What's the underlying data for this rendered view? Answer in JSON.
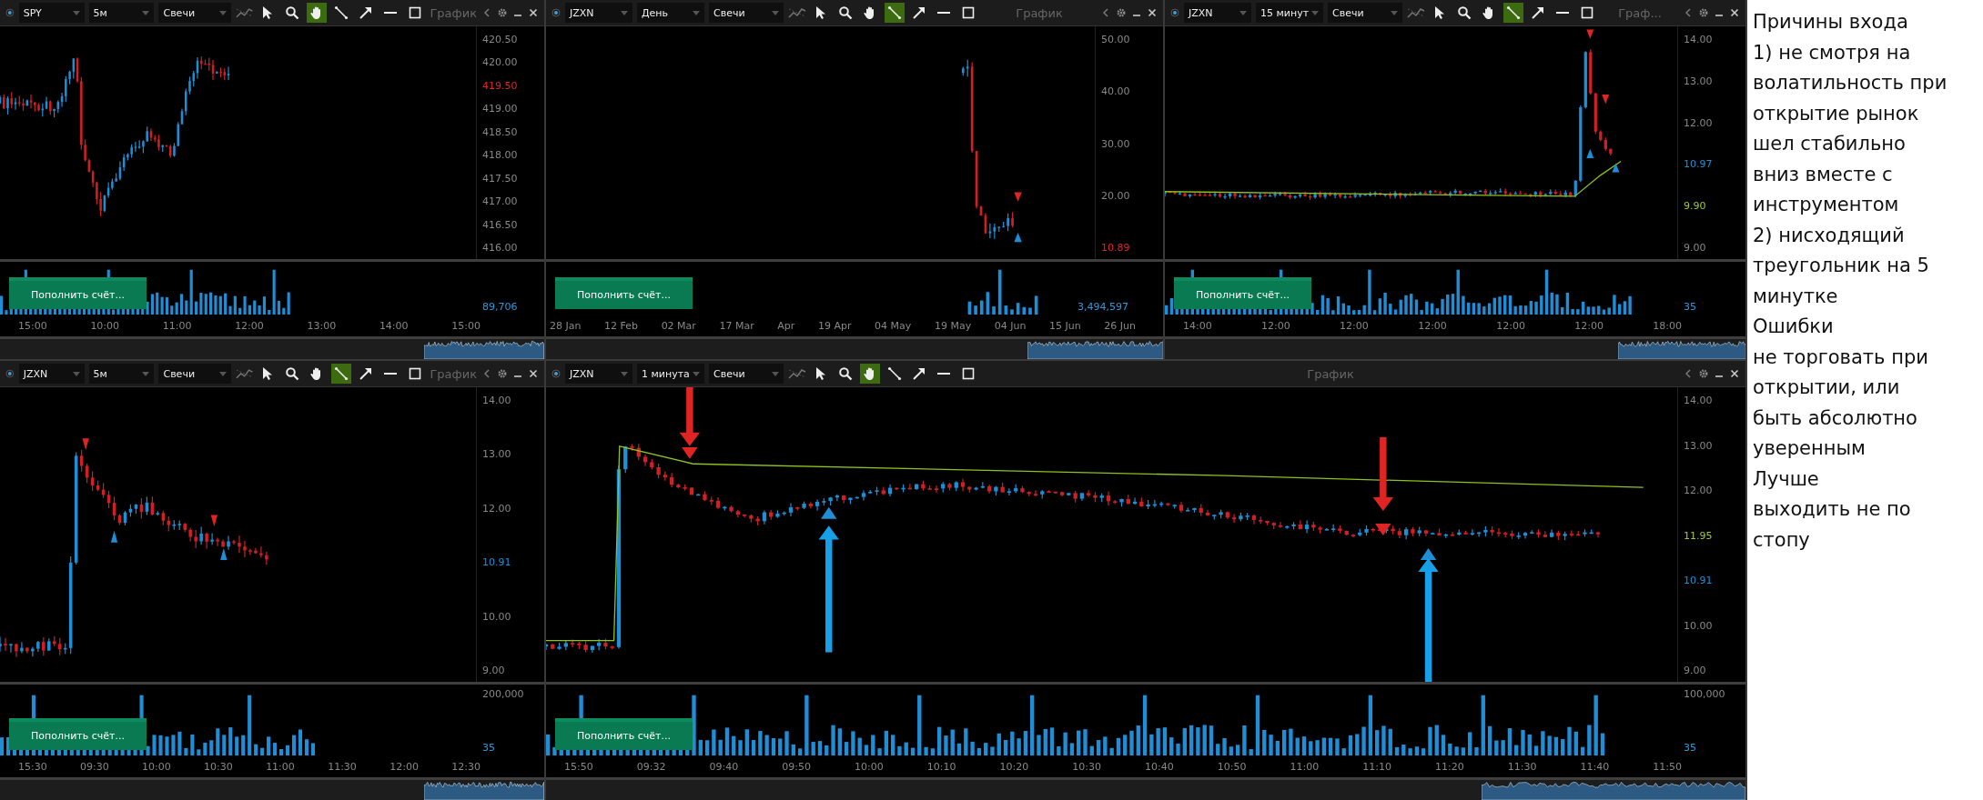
{
  "charts": [
    {
      "symbol": "SPY",
      "interval": "5м",
      "chart_type": "Свечи",
      "title": "График",
      "tools": [
        {
          "kind": "pointer",
          "selected": false
        },
        {
          "kind": "zoom",
          "selected": false
        },
        {
          "kind": "hand",
          "selected": true
        },
        {
          "kind": "line",
          "selected": false
        },
        {
          "kind": "arrow",
          "selected": false
        },
        {
          "kind": "hline",
          "selected": false
        },
        {
          "kind": "rectangle",
          "selected": false
        }
      ],
      "price_axis": [
        {
          "kind": "tick",
          "text": "420.50"
        },
        {
          "kind": "tick",
          "text": "420.00"
        },
        {
          "kind": "tag",
          "text": "419.50",
          "color": "#e02424"
        },
        {
          "kind": "tick",
          "text": "419.00"
        },
        {
          "kind": "tick",
          "text": "418.50"
        },
        {
          "kind": "tick",
          "text": "418.00"
        },
        {
          "kind": "tick",
          "text": "417.50"
        },
        {
          "kind": "tick",
          "text": "417.00"
        },
        {
          "kind": "tick",
          "text": "416.50"
        },
        {
          "kind": "tick",
          "text": "416.00"
        }
      ],
      "volume_axis": [
        {
          "kind": "tag",
          "text": "89,706"
        }
      ],
      "deposit_button": "Пополнить счёт...",
      "time_axis": [
        "15:00",
        "10:00",
        "11:00",
        "12:00",
        "13:00",
        "14:00",
        "15:00"
      ]
    },
    {
      "symbol": "JZXN",
      "interval": "День",
      "chart_type": "Свечи",
      "title": "График",
      "tools": [
        {
          "kind": "pointer",
          "selected": false
        },
        {
          "kind": "zoom",
          "selected": false
        },
        {
          "kind": "hand",
          "selected": false
        },
        {
          "kind": "line",
          "selected": true
        },
        {
          "kind": "arrow",
          "selected": false
        },
        {
          "kind": "hline",
          "selected": false
        },
        {
          "kind": "rectangle",
          "selected": false
        }
      ],
      "price_axis": [
        {
          "kind": "tick",
          "text": "50.00"
        },
        {
          "kind": "tick",
          "text": "40.00"
        },
        {
          "kind": "tick",
          "text": "30.00"
        },
        {
          "kind": "tick",
          "text": "20.00"
        },
        {
          "kind": "tag",
          "text": "10.89",
          "color": "#e02424"
        }
      ],
      "volume_axis": [
        {
          "kind": "tag",
          "text": "3,494,597"
        }
      ],
      "deposit_button": "Пополнить счёт...",
      "time_axis": [
        "28 Jan",
        "12 Feb",
        "02 Mar",
        "17 Mar",
        "Apr",
        "19 Apr",
        "04 May",
        "19 May",
        "04 Jun",
        "15 Jun",
        "26 Jun"
      ]
    },
    {
      "symbol": "JZXN",
      "interval": "15 минут",
      "chart_type": "Свечи",
      "title": "Граф...",
      "tools": [
        {
          "kind": "pointer",
          "selected": false
        },
        {
          "kind": "zoom",
          "selected": false
        },
        {
          "kind": "hand",
          "selected": false
        },
        {
          "kind": "line",
          "selected": true
        },
        {
          "kind": "arrow",
          "selected": false
        },
        {
          "kind": "hline",
          "selected": false
        },
        {
          "kind": "rectangle",
          "selected": false
        }
      ],
      "price_axis": [
        {
          "kind": "tick",
          "text": "14.00"
        },
        {
          "kind": "tick",
          "text": "13.00"
        },
        {
          "kind": "tick",
          "text": "12.00"
        },
        {
          "kind": "tag",
          "text": "10.97",
          "color": "#1e8fd6"
        },
        {
          "kind": "tag",
          "text": "9.90",
          "color": "#9ccc2c"
        },
        {
          "kind": "tick",
          "text": "9.00"
        }
      ],
      "volume_axis": [
        {
          "kind": "tag",
          "text": "35"
        }
      ],
      "deposit_button": "Пополнить счёт...",
      "time_axis": [
        "14:00",
        "12:00",
        "12:00",
        "12:00",
        "12:00",
        "12:00",
        "18:00"
      ]
    },
    {
      "symbol": "JZXN",
      "interval": "5м",
      "chart_type": "Свечи",
      "title": "График",
      "tools": [
        {
          "kind": "pointer",
          "selected": false
        },
        {
          "kind": "zoom",
          "selected": false
        },
        {
          "kind": "hand",
          "selected": false
        },
        {
          "kind": "line",
          "selected": true
        },
        {
          "kind": "arrow",
          "selected": false
        },
        {
          "kind": "hline",
          "selected": false
        },
        {
          "kind": "rectangle",
          "selected": false
        }
      ],
      "price_axis": [
        {
          "kind": "tick",
          "text": "14.00"
        },
        {
          "kind": "tick",
          "text": "13.00"
        },
        {
          "kind": "tick",
          "text": "12.00"
        },
        {
          "kind": "tag",
          "text": "10.91",
          "color": "#1e8fd6"
        },
        {
          "kind": "tick",
          "text": "10.00"
        },
        {
          "kind": "tick",
          "text": "9.00"
        }
      ],
      "volume_axis": [
        {
          "kind": "tick",
          "text": "200,000"
        },
        {
          "kind": "tag",
          "text": "35"
        }
      ],
      "deposit_button": "Пополнить счёт...",
      "time_axis": [
        "15:30",
        "09:30",
        "10:00",
        "10:30",
        "11:00",
        "11:30",
        "12:00",
        "12:30"
      ]
    },
    {
      "symbol": "JZXN",
      "interval": "1 минута",
      "chart_type": "Свечи",
      "title": "График",
      "tools": [
        {
          "kind": "pointer",
          "selected": false
        },
        {
          "kind": "zoom",
          "selected": false
        },
        {
          "kind": "hand",
          "selected": true
        },
        {
          "kind": "line",
          "selected": false
        },
        {
          "kind": "arrow",
          "selected": false
        },
        {
          "kind": "hline",
          "selected": false
        },
        {
          "kind": "rectangle",
          "selected": false
        }
      ],
      "price_axis": [
        {
          "kind": "tick",
          "text": "14.00"
        },
        {
          "kind": "tick",
          "text": "13.00"
        },
        {
          "kind": "tick",
          "text": "12.00"
        },
        {
          "kind": "tag",
          "text": "11.95",
          "color": "#9ccc2c"
        },
        {
          "kind": "tag",
          "text": "10.91",
          "color": "#1e8fd6"
        },
        {
          "kind": "tick",
          "text": "10.00"
        },
        {
          "kind": "tick",
          "text": "9.00"
        }
      ],
      "volume_axis": [
        {
          "kind": "tick",
          "text": "100,000"
        },
        {
          "kind": "tag",
          "text": "35"
        }
      ],
      "deposit_button": "Пополнить счёт...",
      "time_axis": [
        "15:50",
        "09:32",
        "09:40",
        "09:50",
        "10:00",
        "10:10",
        "10:20",
        "10:30",
        "10:40",
        "10:50",
        "11:00",
        "11:10",
        "11:20",
        "11:30",
        "11:40",
        "11:50"
      ]
    }
  ],
  "notes": [
    "Причины входа",
    "1) не смотря на",
    "волатильность при",
    "открытие рынок",
    "шел стабильно",
    "вниз вместе с",
    "инструментом",
    "2) нисходящий",
    "треугольник на 5",
    "минутке",
    "Ошибки",
    "не торговать при",
    "открытии, или",
    "быть абсолютно",
    "уверенным",
    "Лучше",
    "выходить не по",
    "стопу"
  ]
}
